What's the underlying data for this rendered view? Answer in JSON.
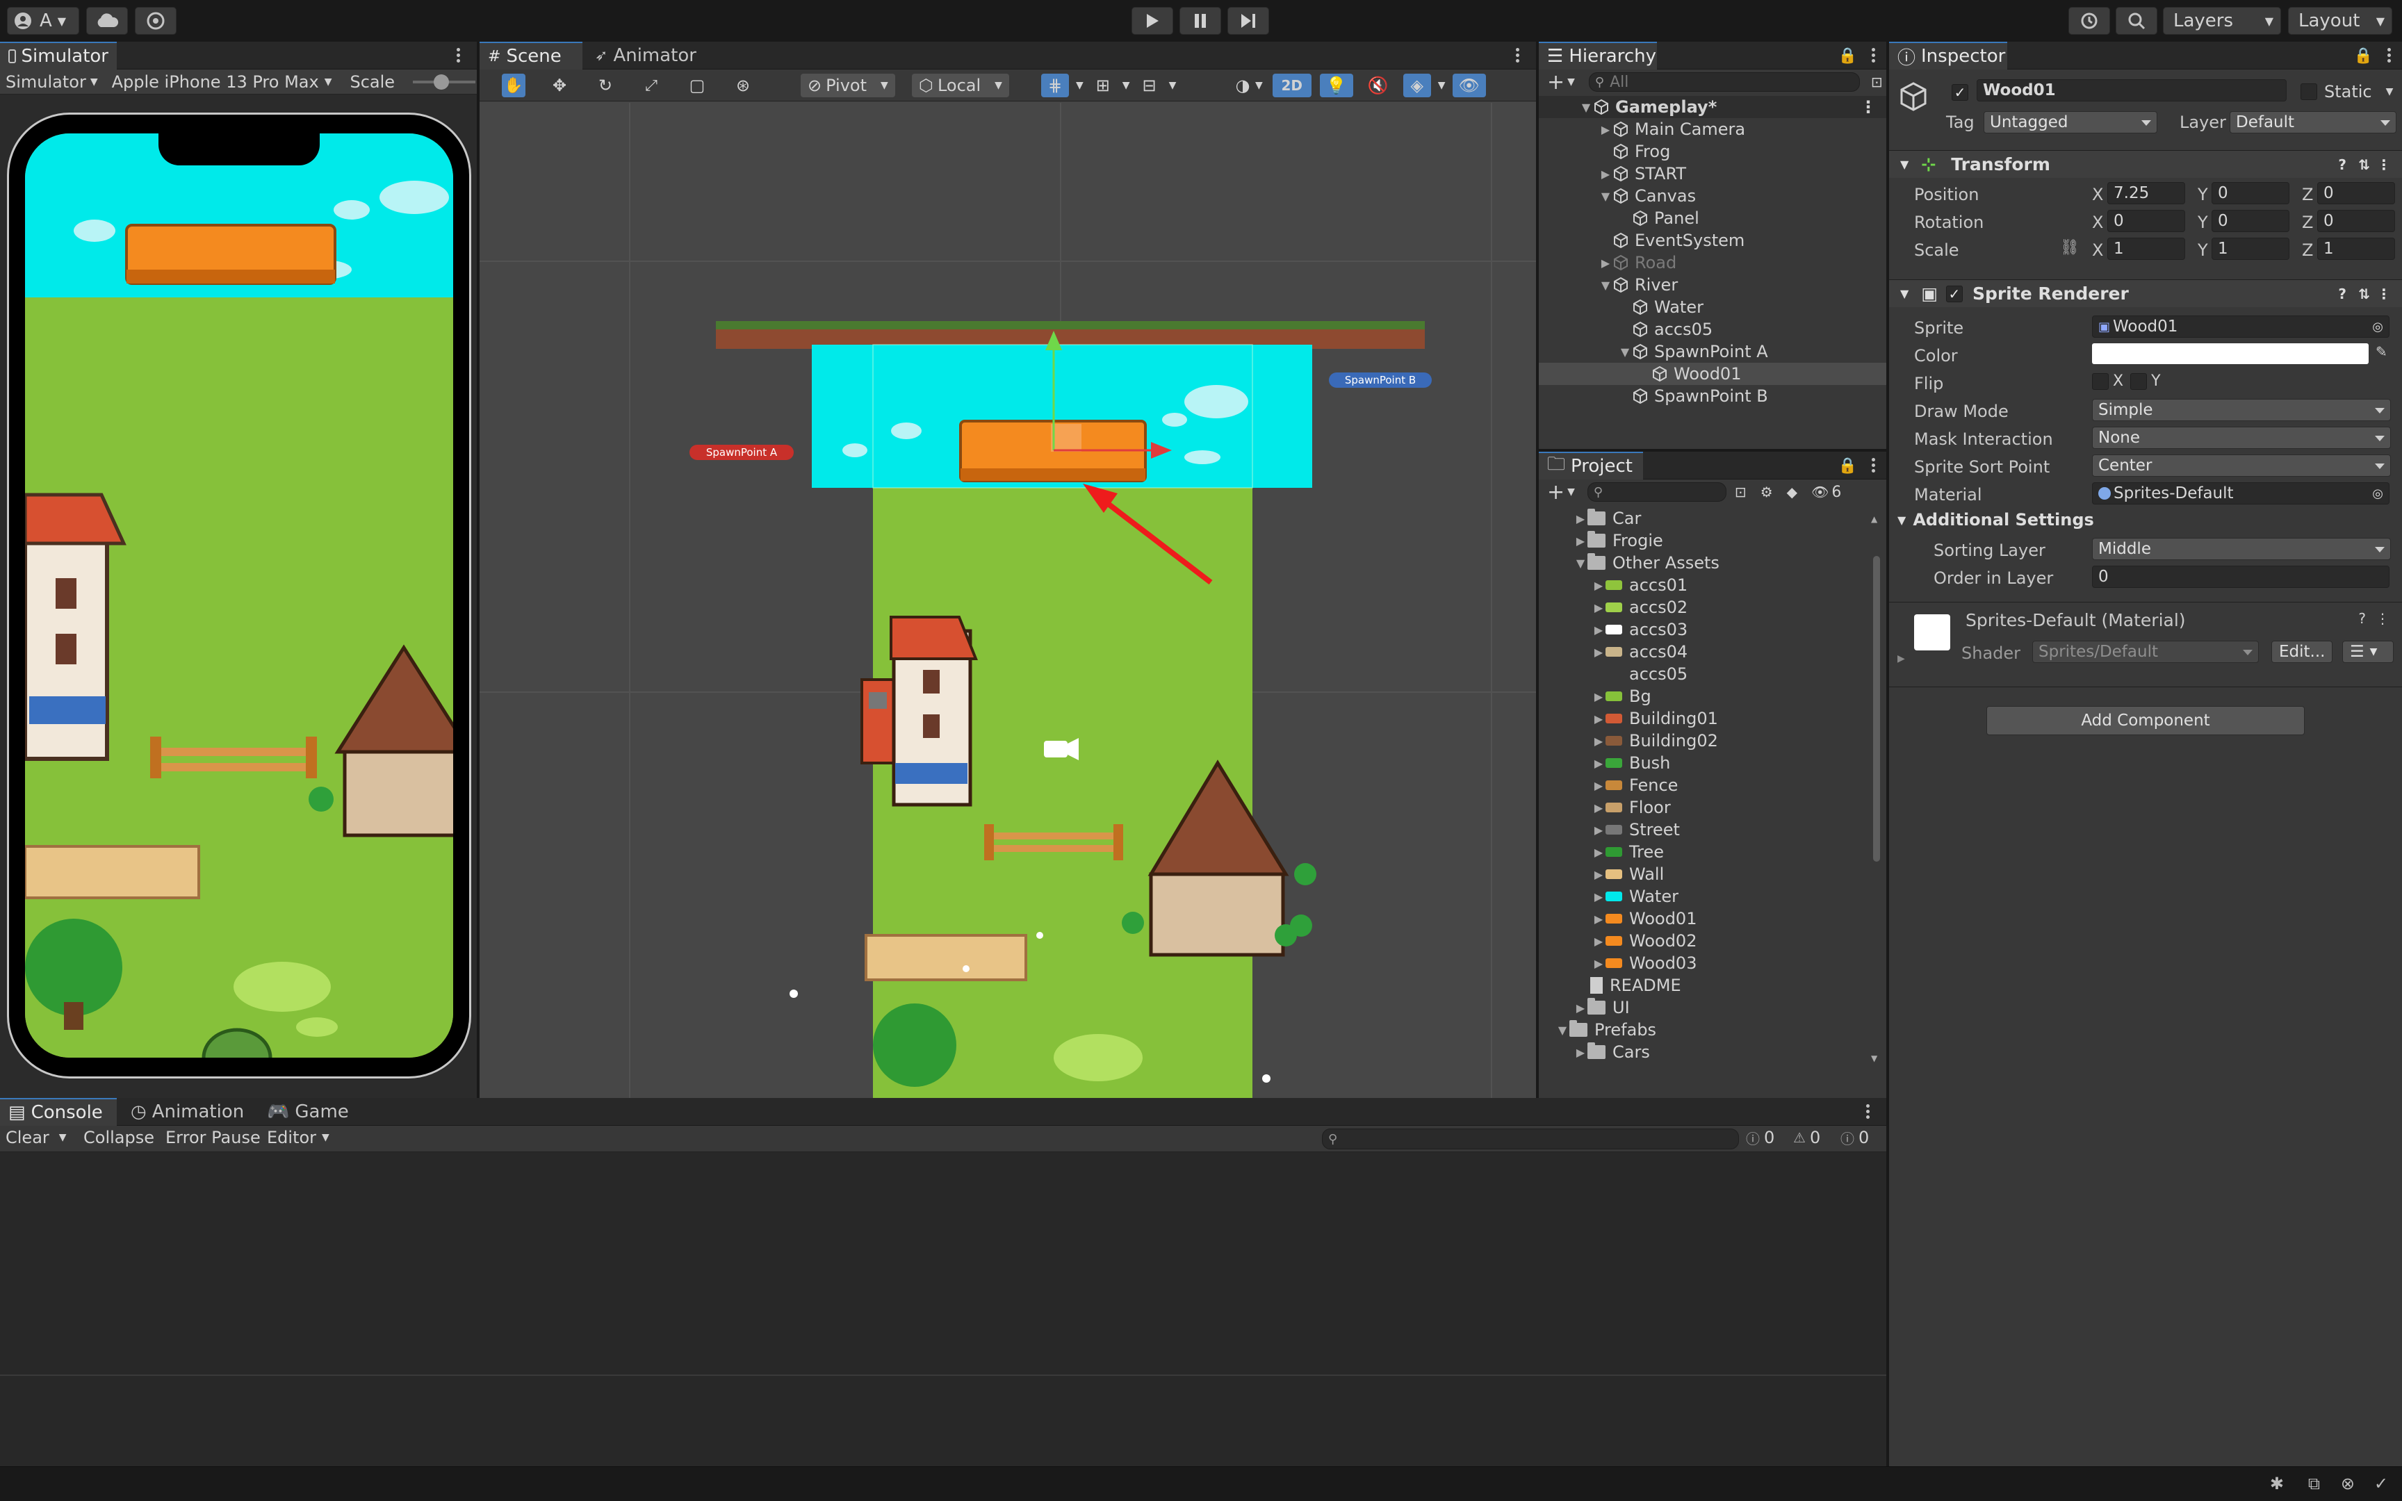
{
  "toolbar": {
    "account_label": "A",
    "layers_label": "Layers",
    "layout_label": "Layout"
  },
  "simulator": {
    "tab": "Simulator",
    "mode": "Simulator",
    "device": "Apple iPhone 13 Pro Max",
    "scale_label": "Scale"
  },
  "scene": {
    "tabs": [
      "Scene",
      "Animator"
    ],
    "pivot": "Pivot",
    "local": "Local",
    "toggle_2d": "2D",
    "spawn_a": "SpawnPoint A",
    "spawn_b": "SpawnPoint B"
  },
  "hierarchy": {
    "tab": "Hierarchy",
    "search_placeholder": "All",
    "items": [
      {
        "label": "Gameplay*",
        "depth": 0,
        "arrow": "▼"
      },
      {
        "label": "Main Camera",
        "depth": 1,
        "arrow": "▶"
      },
      {
        "label": "Frog",
        "depth": 1,
        "arrow": ""
      },
      {
        "label": "START",
        "depth": 1,
        "arrow": "▶"
      },
      {
        "label": "Canvas",
        "depth": 1,
        "arrow": "▼"
      },
      {
        "label": "Panel",
        "depth": 2,
        "arrow": ""
      },
      {
        "label": "EventSystem",
        "depth": 1,
        "arrow": ""
      },
      {
        "label": "Road",
        "depth": 1,
        "arrow": "▶"
      },
      {
        "label": "River",
        "depth": 1,
        "arrow": "▼"
      },
      {
        "label": "Water",
        "depth": 2,
        "arrow": ""
      },
      {
        "label": "accs05",
        "depth": 2,
        "arrow": ""
      },
      {
        "label": "SpawnPoint A",
        "depth": 2,
        "arrow": "▼"
      },
      {
        "label": "Wood01",
        "depth": 3,
        "arrow": ""
      },
      {
        "label": "SpawnPoint B",
        "depth": 2,
        "arrow": ""
      }
    ]
  },
  "project": {
    "tab": "Project",
    "hidden_count": "6",
    "items": [
      {
        "label": "Car",
        "depth": 1,
        "arrow": "▶",
        "kind": "folder"
      },
      {
        "label": "Frogie",
        "depth": 1,
        "arrow": "▶",
        "kind": "folder"
      },
      {
        "label": "Other Assets",
        "depth": 1,
        "arrow": "▼",
        "kind": "folder-open"
      },
      {
        "label": "accs01",
        "depth": 2,
        "arrow": "▶",
        "kind": "sprite",
        "color": "#8fc43c"
      },
      {
        "label": "accs02",
        "depth": 2,
        "arrow": "▶",
        "kind": "sprite",
        "color": "#9fd04a"
      },
      {
        "label": "accs03",
        "depth": 2,
        "arrow": "▶",
        "kind": "sprite",
        "color": "#ffffff"
      },
      {
        "label": "accs04",
        "depth": 2,
        "arrow": "▶",
        "kind": "sprite",
        "color": "#c9b48a"
      },
      {
        "label": "accs05",
        "depth": 2,
        "arrow": "",
        "kind": "sprite",
        "color": "#383838"
      },
      {
        "label": "Bg",
        "depth": 2,
        "arrow": "▶",
        "kind": "sprite",
        "color": "#86c13a"
      },
      {
        "label": "Building01",
        "depth": 2,
        "arrow": "▶",
        "kind": "sprite",
        "color": "#d25a35"
      },
      {
        "label": "Building02",
        "depth": 2,
        "arrow": "▶",
        "kind": "sprite",
        "color": "#8a5a3a"
      },
      {
        "label": "Bush",
        "depth": 2,
        "arrow": "▶",
        "kind": "sprite",
        "color": "#3aa63a"
      },
      {
        "label": "Fence",
        "depth": 2,
        "arrow": "▶",
        "kind": "sprite",
        "color": "#c8883a"
      },
      {
        "label": "Floor",
        "depth": 2,
        "arrow": "▶",
        "kind": "sprite",
        "color": "#c8a06a"
      },
      {
        "label": "Street",
        "depth": 2,
        "arrow": "▶",
        "kind": "sprite",
        "color": "#777777"
      },
      {
        "label": "Tree",
        "depth": 2,
        "arrow": "▶",
        "kind": "sprite",
        "color": "#2f9a33"
      },
      {
        "label": "Wall",
        "depth": 2,
        "arrow": "▶",
        "kind": "sprite",
        "color": "#e6c080"
      },
      {
        "label": "Water",
        "depth": 2,
        "arrow": "▶",
        "kind": "sprite",
        "color": "#00e8ea"
      },
      {
        "label": "Wood01",
        "depth": 2,
        "arrow": "▶",
        "kind": "sprite",
        "color": "#f48a1f"
      },
      {
        "label": "Wood02",
        "depth": 2,
        "arrow": "▶",
        "kind": "sprite",
        "color": "#f48a1f"
      },
      {
        "label": "Wood03",
        "depth": 2,
        "arrow": "▶",
        "kind": "sprite",
        "color": "#f48a1f"
      },
      {
        "label": "README",
        "depth": 1,
        "arrow": "",
        "kind": "file"
      },
      {
        "label": "UI",
        "depth": 1,
        "arrow": "▶",
        "kind": "folder"
      },
      {
        "label": "Prefabs",
        "depth": 0,
        "arrow": "▼",
        "kind": "folder-open"
      },
      {
        "label": "Cars",
        "depth": 1,
        "arrow": "▶",
        "kind": "folder"
      }
    ]
  },
  "inspector": {
    "tab": "Inspector",
    "object_name": "Wood01",
    "static_label": "Static",
    "tag_label": "Tag",
    "tag_value": "Untagged",
    "layer_label": "Layer",
    "layer_value": "Default",
    "transform": {
      "title": "Transform",
      "position_label": "Position",
      "rotation_label": "Rotation",
      "scale_label": "Scale",
      "position": {
        "x": "7.25",
        "y": "0",
        "z": "0"
      },
      "rotation": {
        "x": "0",
        "y": "0",
        "z": "0"
      },
      "scale": {
        "x": "1",
        "y": "1",
        "z": "1"
      }
    },
    "sprite_renderer": {
      "title": "Sprite Renderer",
      "sprite_label": "Sprite",
      "sprite_value": "Wood01",
      "color_label": "Color",
      "color_value": "#ffffff",
      "flip_label": "Flip",
      "draw_mode_label": "Draw Mode",
      "draw_mode_value": "Simple",
      "mask_label": "Mask Interaction",
      "mask_value": "None",
      "sort_point_label": "Sprite Sort Point",
      "sort_point_value": "Center",
      "material_label": "Material",
      "material_value": "Sprites-Default",
      "additional_label": "Additional Settings",
      "sorting_layer_label": "Sorting Layer",
      "sorting_layer_value": "Middle",
      "order_label": "Order in Layer",
      "order_value": "0"
    },
    "material": {
      "title": "Sprites-Default (Material)",
      "shader_label": "Shader",
      "shader_value": "Sprites/Default",
      "edit_label": "Edit..."
    },
    "add_component": "Add Component"
  },
  "console": {
    "tabs": [
      "Console",
      "Animation",
      "Game"
    ],
    "clear": "Clear",
    "collapse": "Collapse",
    "error_pause": "Error Pause",
    "editor": "Editor",
    "count_info": "0",
    "count_warn": "0",
    "count_error": "0"
  }
}
